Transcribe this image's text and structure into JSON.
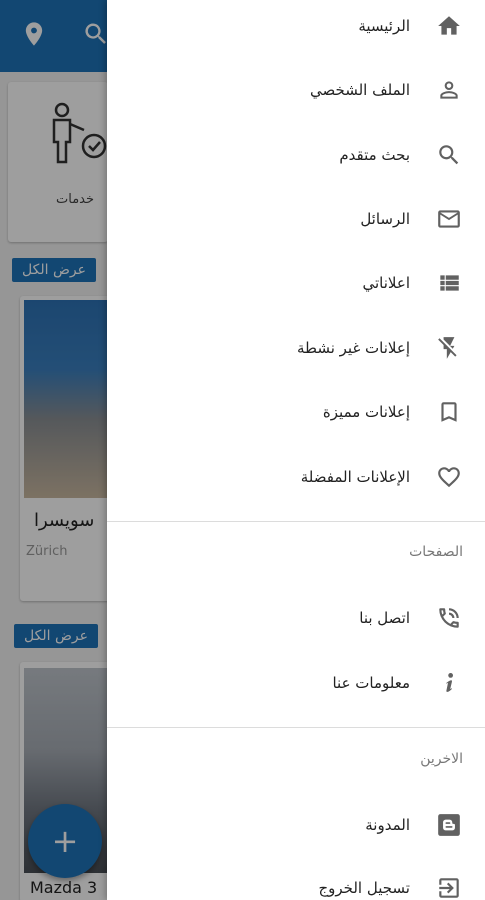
{
  "background": {
    "services_label": "خدمات",
    "view_all_label": "عرض الكل",
    "listing_title": "سويسرا",
    "listing_location": "Zürich",
    "second_listing_title": "Mazda 3",
    "fab_label": "+"
  },
  "drawer": {
    "main_items": [
      {
        "label": "الرئيسية",
        "icon": "home-icon"
      },
      {
        "label": "الملف الشخصي",
        "icon": "person-icon"
      },
      {
        "label": "بحث متقدم",
        "icon": "search-icon"
      },
      {
        "label": "الرسائل",
        "icon": "mail-icon"
      },
      {
        "label": "اعلاناتي",
        "icon": "list-icon"
      },
      {
        "label": "إعلانات غير نشطة",
        "icon": "flash-off-icon"
      },
      {
        "label": "إعلانات مميزة",
        "icon": "bookmark-icon"
      },
      {
        "label": "الإعلانات المفضلة",
        "icon": "heart-icon"
      }
    ],
    "pages_section": {
      "title": "الصفحات",
      "items": [
        {
          "label": "اتصل بنا",
          "icon": "phone-ringing-icon"
        },
        {
          "label": "معلومات عنا",
          "icon": "info-icon"
        }
      ]
    },
    "others_section": {
      "title": "الاخرين",
      "items": [
        {
          "label": "المدونة",
          "icon": "blogger-icon"
        },
        {
          "label": "تسجيل الخروج",
          "icon": "logout-icon"
        }
      ]
    }
  },
  "colors": {
    "primary": "#1e73b8",
    "icon": "#616161",
    "text": "#222222",
    "section_title": "#777777"
  }
}
